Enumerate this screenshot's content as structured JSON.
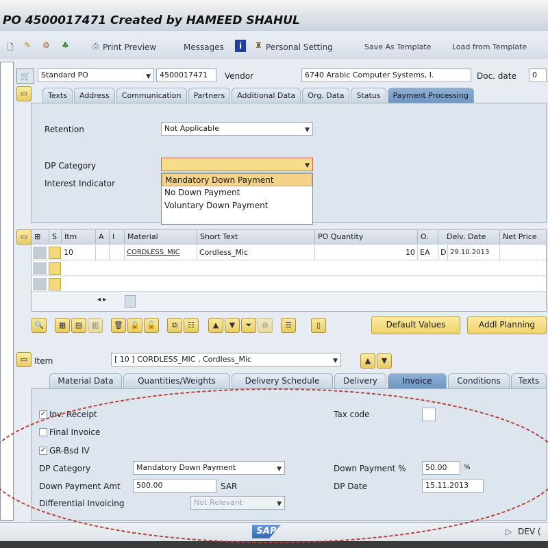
{
  "window": {
    "title": "PO 4500017471 Created by HAMEED SHAHUL"
  },
  "toolbar": {
    "print_preview": "Print Preview",
    "messages": "Messages",
    "personal_setting": "Personal Setting",
    "save_as_template": "Save As Template",
    "load_from_template": "Load from Template"
  },
  "header": {
    "doc_type": "Standard PO",
    "po_number": "4500017471",
    "vendor_label": "Vendor",
    "vendor_value": "6740 Arabic Computer Systems, I.",
    "doc_date_label": "Doc. date",
    "doc_date_value": "0"
  },
  "header_tabs": [
    "Texts",
    "Address",
    "Communication",
    "Partners",
    "Additional Data",
    "Org. Data",
    "Status",
    "Payment Processing"
  ],
  "payment": {
    "retention_label": "Retention",
    "retention_value": "Not Applicable",
    "dp_category_label": "DP Category",
    "dp_category_value": "",
    "interest_label": "Interest Indicator",
    "dp_options": [
      "Mandatory Down Payment",
      "No Down Payment",
      "Voluntary Down Payment"
    ]
  },
  "items_table": {
    "columns": [
      "S",
      "Itm",
      "A",
      "I",
      "Material",
      "Short Text",
      "PO Quantity",
      "O.",
      "Delv. Date",
      "Net Price"
    ],
    "rows": [
      {
        "itm": "10",
        "material": "CORDLESS_MIC",
        "short_text": "Cordless_Mic",
        "qty": "10",
        "unit": "EA",
        "d": "D",
        "date": "29.10.2013"
      }
    ]
  },
  "item_buttons": {
    "default_values": "Default Values",
    "addl_planning": "Addl Planning"
  },
  "item_detail": {
    "label": "Item",
    "selected": "[ 10 ] CORDLESS_MIC , Cordless_Mic"
  },
  "item_tabs": [
    "Material Data",
    "Quantities/Weights",
    "Delivery Schedule",
    "Delivery",
    "Invoice",
    "Conditions",
    "Texts"
  ],
  "invoice": {
    "inv_receipt": "Inv. Receipt",
    "final_invoice": "Final Invoice",
    "gr_bsd_iv": "GR-Bsd IV",
    "tax_code_label": "Tax code",
    "dp_category_label": "DP Category",
    "dp_category_value": "Mandatory Down Payment",
    "dp_amt_label": "Down Payment Amt",
    "dp_amt_value": "500.00",
    "currency": "SAR",
    "dp_pct_label": "Down Payment %",
    "dp_pct_value": "50.00",
    "pct_sign": "%",
    "dp_date_label": "DP Date",
    "dp_date_value": "15.11.2013",
    "diff_inv_label": "Differential Invoicing",
    "diff_inv_value": "Not Relevant"
  },
  "status": {
    "logo": "SAP",
    "system": "DEV ("
  }
}
